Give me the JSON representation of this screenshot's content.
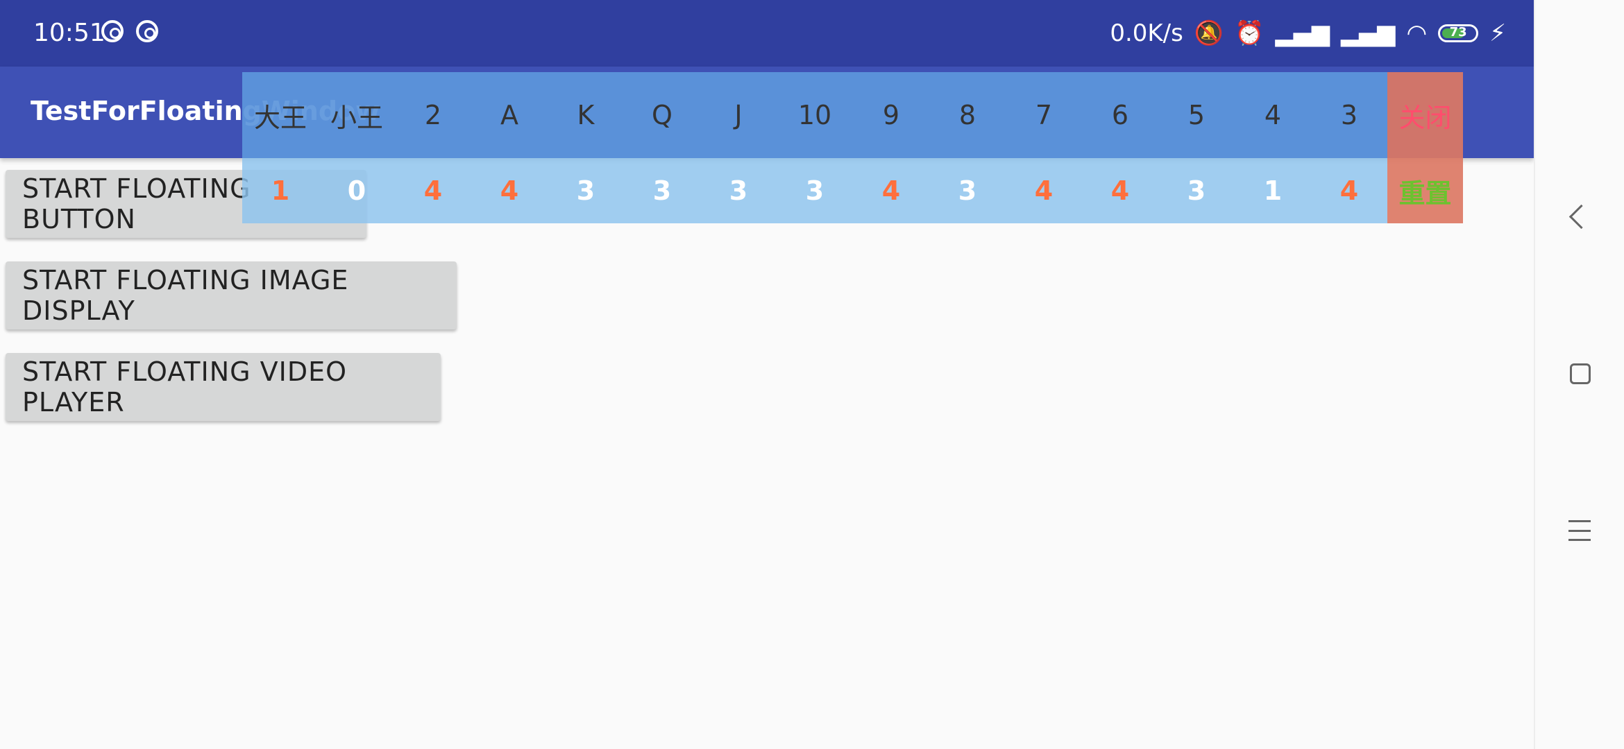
{
  "status_bar": {
    "time": "10:51",
    "net_speed": "0.0K/s",
    "battery": 73,
    "battery_label": "73",
    "icons": [
      "app-notification-icon",
      "app-notification-icon",
      "mute-icon",
      "alarm-icon",
      "signal-icon",
      "hd-signal-icon",
      "wifi-icon",
      "battery-icon",
      "charging-icon"
    ]
  },
  "app_bar": {
    "title": "TestForFloatingWindow"
  },
  "buttons": {
    "floating_button": "START FLOATING BUTTON",
    "floating_image": "START FLOATING IMAGE DISPLAY",
    "floating_video": "START FLOATING VIDEO PLAYER"
  },
  "floating_window": {
    "cards": [
      {
        "label": "大王",
        "count": "1",
        "highlight": true
      },
      {
        "label": "小王",
        "count": "0",
        "highlight": false
      },
      {
        "label": "2",
        "count": "4",
        "highlight": true
      },
      {
        "label": "A",
        "count": "4",
        "highlight": true
      },
      {
        "label": "K",
        "count": "3",
        "highlight": false
      },
      {
        "label": "Q",
        "count": "3",
        "highlight": false
      },
      {
        "label": "J",
        "count": "3",
        "highlight": false
      },
      {
        "label": "10",
        "count": "3",
        "highlight": false
      },
      {
        "label": "9",
        "count": "4",
        "highlight": true
      },
      {
        "label": "8",
        "count": "3",
        "highlight": false
      },
      {
        "label": "7",
        "count": "4",
        "highlight": true
      },
      {
        "label": "6",
        "count": "4",
        "highlight": true
      },
      {
        "label": "5",
        "count": "3",
        "highlight": false
      },
      {
        "label": "4",
        "count": "1",
        "highlight": false
      },
      {
        "label": "3",
        "count": "4",
        "highlight": true
      }
    ],
    "close_label": "关闭",
    "reset_label": "重置"
  },
  "colors": {
    "status_bar": "#303f9f",
    "app_bar": "#3f51b5",
    "highlight_count": "#ff6f3c",
    "close_text": "#ff4d6d",
    "reset_text": "#6cc22f"
  }
}
